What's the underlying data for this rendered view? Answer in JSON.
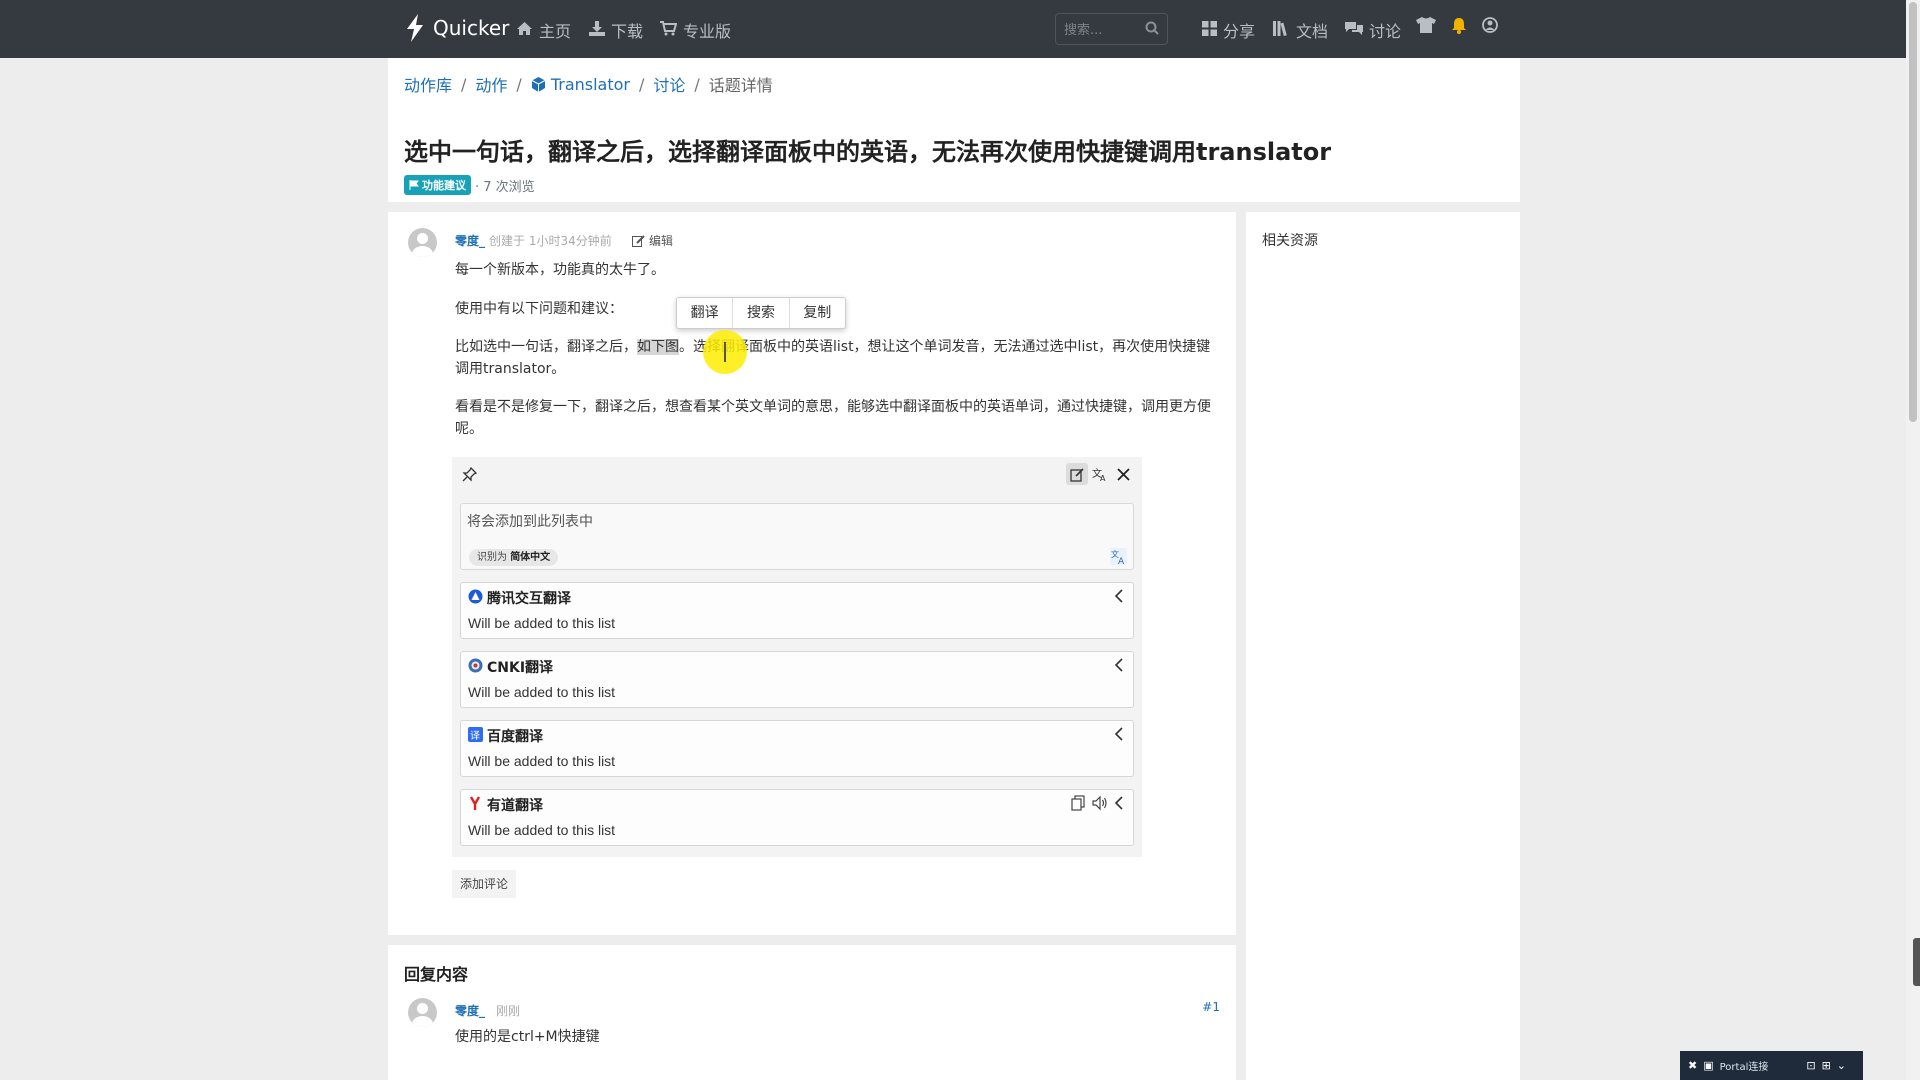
{
  "nav": {
    "brand": "Quicker",
    "links": [
      {
        "icon": "home-icon",
        "label": "主页"
      },
      {
        "icon": "download-icon",
        "label": "下载"
      },
      {
        "icon": "cart-icon",
        "label": "专业版"
      }
    ],
    "search_placeholder": "搜索...",
    "right": [
      {
        "icon": "grid-icon",
        "label": "分享"
      },
      {
        "icon": "books-icon",
        "label": "文档"
      },
      {
        "icon": "comments-icon",
        "label": "讨论"
      }
    ],
    "right_icons": [
      "tshirt-icon",
      "bell-icon",
      "user-circle-icon"
    ]
  },
  "breadcrumb": {
    "items": [
      "动作库",
      "动作",
      "Translator",
      "讨论"
    ],
    "current": "话题详情",
    "separator": "/"
  },
  "topic": {
    "title": "选中一句话，翻译之后，选择翻译面板中的英语，无法再次使用快捷键调用translator",
    "tag": "功能建议",
    "views": "· 7 次浏览"
  },
  "post": {
    "author": "零度_",
    "created": "创建于 1小时34分钟前",
    "edit_label": "编辑",
    "p1": "每一个新版本，功能真的太牛了。",
    "p2": "使用中有以下问题和建议：",
    "p3_before": "比如选中一句话，翻译之后，",
    "p3_highlight": "如下图",
    "p3_after": "。选择翻译面板中的英语list，想让这个单词发音，无法通过选中list，再次使用快捷键调用translator。",
    "p4": "看看是不是修复一下，翻译之后，想查看某个英文单词的意思，能够选中翻译面板中的英语单词，通过快捷键，调用更方便呢。",
    "add_comment": "添加评论"
  },
  "selection_popup": [
    "翻译",
    "搜索",
    "复制"
  ],
  "translator": {
    "input_placeholder": "将会添加到此列表中",
    "detected_prefix": "识别为",
    "detected_lang": "简体中文",
    "results": [
      {
        "name": "腾讯交互翻译",
        "text": "Will be added to this list",
        "icon": "tencent-logo-icon"
      },
      {
        "name": "CNKI翻译",
        "text": "Will be added to this list",
        "icon": "cnki-logo-icon"
      },
      {
        "name": "百度翻译",
        "text": "Will be added to this list",
        "icon": "baidu-logo-icon"
      },
      {
        "name": "有道翻译",
        "text": "Will be added to this list",
        "icon": "youdao-logo-icon"
      }
    ]
  },
  "sidebar": {
    "title": "相关资源"
  },
  "reply": {
    "heading": "回复内容",
    "author": "零度_",
    "time": "刚刚",
    "number": "#1",
    "text": "使用的是ctrl+M快捷键"
  },
  "taskbar": {
    "label": "Portal连接"
  },
  "colors": {
    "nav_bg": "#343a40",
    "link": "#1d6fb8",
    "tag_bg": "#17a2b8",
    "page_bg": "#ededed"
  }
}
